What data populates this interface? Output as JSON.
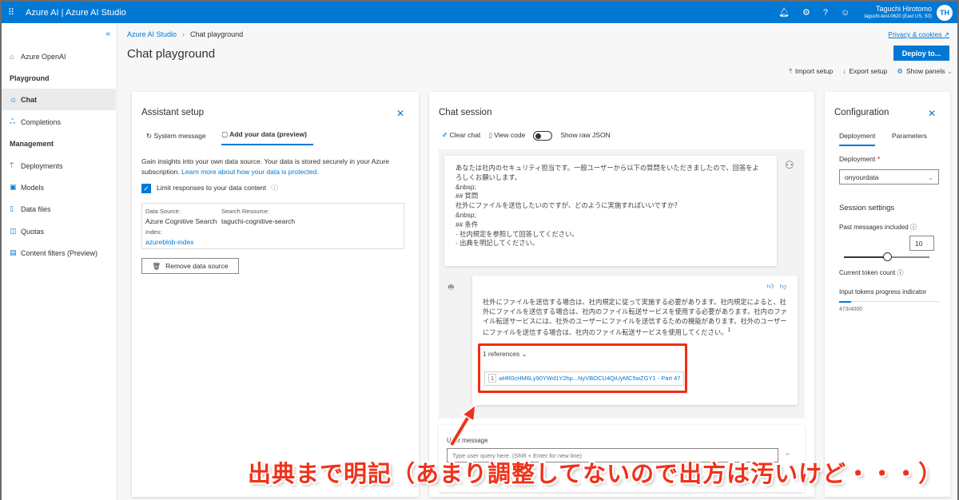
{
  "topbar": {
    "brand": "Azure AI  |  Azure AI Studio",
    "user_name": "Taguchi Hirotomo",
    "user_sub": "taguchi-test-0620 (East US, S0)",
    "avatar": "TH"
  },
  "sidebar": {
    "items": [
      {
        "label": "Azure OpenAI",
        "icon": "home-icon"
      },
      {
        "label": "Playground",
        "heading": true
      },
      {
        "label": "Chat",
        "icon": "chat-bot-icon",
        "active": true
      },
      {
        "label": "Completions",
        "icon": "completions-icon"
      },
      {
        "label": "Management",
        "heading": true
      },
      {
        "label": "Deployments",
        "icon": "deployments-icon"
      },
      {
        "label": "Models",
        "icon": "models-icon"
      },
      {
        "label": "Data files",
        "icon": "data-files-icon"
      },
      {
        "label": "Quotas",
        "icon": "quotas-icon"
      },
      {
        "label": "Content filters (Preview)",
        "icon": "content-filters-icon"
      }
    ]
  },
  "header": {
    "breadcrumb_root": "Azure AI Studio",
    "breadcrumb_current": "Chat playground",
    "title": "Chat playground",
    "privacy": "Privacy & cookies",
    "deploy": "Deploy to...",
    "import": "Import setup",
    "export": "Export setup",
    "show_panels": "Show panels"
  },
  "assistant": {
    "title": "Assistant setup",
    "tab_system": "System message",
    "tab_data": "Add your data (preview)",
    "desc": "Gain insights into your own data source. Your data is stored securely in your Azure subscription. ",
    "desc_link": "Learn more about how your data is protected.",
    "limit_label": "Limit responses to your data content",
    "limit_checked": true,
    "ds_label": "Data Source:",
    "ds_value": "Azure Cognitive Search",
    "sr_label": "Search Resource:",
    "sr_value": "taguchi-cognitive-search",
    "index_label": "Index:",
    "index_value": "azureblob-index",
    "remove": "Remove data source"
  },
  "chat": {
    "title": "Chat session",
    "clear": "Clear chat",
    "view_code": "View code",
    "raw_json": "Show raw JSON",
    "raw_json_on": false,
    "user_msg": "あなたは社内のセキュリティ担当です。一般ユーザーから以下の質問をいただきましたので、回答をよろしくお願いします。\n&nbsp;\n## 質問\n社外にファイルを送信したいのですが、どのように実施すればいいですか？\n&nbsp;\n## 条件\n- 社内規定を参照して回答してください。\n- 出典を明記してください。",
    "bot_msg": "社外にファイルを送信する場合は、社内規定に従って実施する必要があります。社内規定によると、社外にファイルを送信する場合は、社内のファイル転送サービスを使用する必要があります。社内のファイル転送サービスには、社外のユーザーにファイルを送信するための機能があります。社外のユーザーにファイルを送信する場合は、社内のファイル転送サービスを使用してください。",
    "citation": "1",
    "references": "1 references",
    "ref_num": "1",
    "ref_text": "aHR0cHM6Ly90YWd1Y2hp...NyVBOCU4QiUyMC5wZGY1 - Part 47",
    "input_label": "User message",
    "input_placeholder": "Type user query here. (Shift + Enter for new line)"
  },
  "config": {
    "title": "Configuration",
    "tab_deployment": "Deployment",
    "tab_parameters": "Parameters",
    "deployment_label": "Deployment",
    "required": "*",
    "deployment_value": "onyourdata",
    "session": "Session settings",
    "past_label": "Past messages included",
    "past_value": "10",
    "past_fraction": 0.5,
    "token_label": "Current token count",
    "progress_label": "Input tokens progress indicator",
    "token_text": "473/4000",
    "token_fraction": 0.118
  },
  "annotation": "出典まで明記（あまり調整してないので出方は汚いけど・・・）"
}
